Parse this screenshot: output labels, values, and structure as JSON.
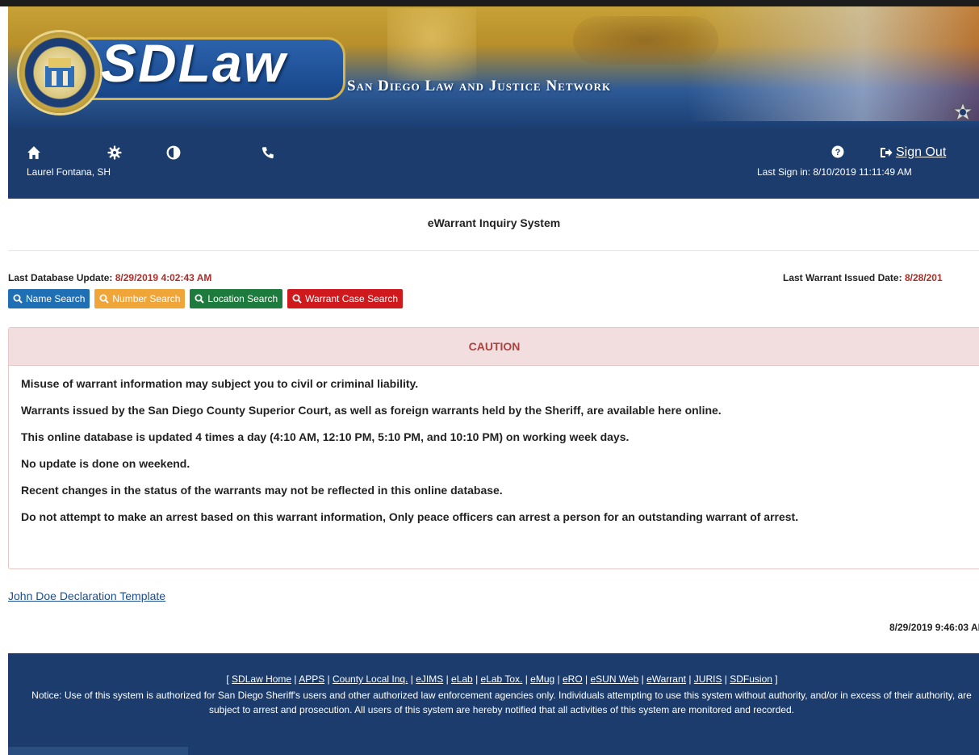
{
  "banner": {
    "logo": "SDLaw",
    "network": "San Diego Law and Justice Network"
  },
  "nav": {
    "icons": [
      "home-icon",
      "gear-icon",
      "contrast-icon",
      "phone-icon",
      "help-icon",
      "sign-out-icon"
    ],
    "user": "Laurel Fontana, SH",
    "sign_out": "Sign Out",
    "last_sign_in": "Last Sign in: 8/10/2019 11:11:49 AM"
  },
  "page": {
    "title": "eWarrant Inquiry System",
    "db_update_label": "Last Database Update:",
    "db_update_value": "8/29/2019 4:02:43 AM",
    "issued_label": "Last Warrant Issued Date:",
    "issued_value": "8/28/201"
  },
  "buttons": {
    "name": "Name Search",
    "number": "Number Search",
    "location": "Location Search",
    "warrant_case": "Warrant Case Search"
  },
  "colors": {
    "nav_bg": "#1b3c6c",
    "blue": "#1f6fb5",
    "orange": "#f0a538",
    "green": "#1e7b3e",
    "red": "#d0191d",
    "caution_text": "#a94442"
  },
  "caution": {
    "title": "CAUTION",
    "lines": [
      "Misuse of warrant information may subject you to civil or criminal liability.",
      "Warrants issued by the San Diego County Superior Court, as well as foreign warrants held by the Sheriff, are available here online.",
      "This online database is updated 4 times a day (4:10 AM, 12:10 PM, 5:10 PM, and 10:10 PM) on working week days.",
      "No update is done on weekend.",
      "Recent changes in the status of the warrants may not be reflected in this online database.",
      "Do not attempt to make an arrest based on this warrant information, Only peace officers can arrest a person for an outstanding warrant of arrest."
    ]
  },
  "john_doe_link": "John Doe Declaration Template",
  "timestamp": "8/29/2019 9:46:03 AI",
  "footer": {
    "open": "[ ",
    "close": " ]",
    "sep": " | ",
    "links": [
      "SDLaw Home",
      "APPS",
      "County Local Inq.",
      "eJIMS",
      "eLab",
      "eLab Tox.",
      "eMug",
      "eRO",
      "eSUN Web",
      "eWarrant",
      "JURIS",
      "SDFusion"
    ],
    "notice": "Notice: Use of this system is authorized for San Diego Sheriff's users and other authorized law enforcement agencies only. Individuals attempting to use this system without authority, and/or in excess of their authority, are subject to arrest and prosecution. All users of this system are hereby notified that all activities of this system are monitored and recorded."
  }
}
